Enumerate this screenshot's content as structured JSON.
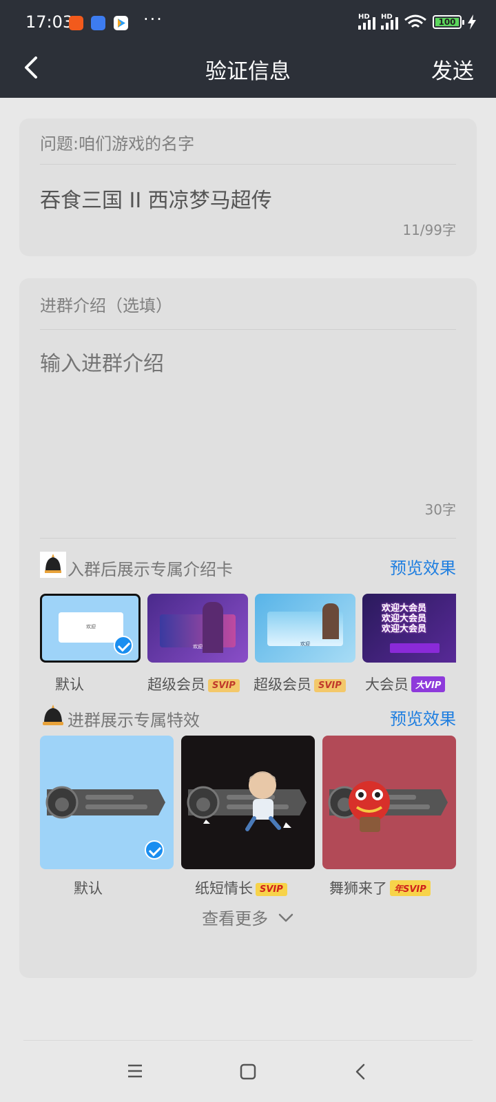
{
  "status": {
    "time": "17:03",
    "dots": "···",
    "battery": "100",
    "hd": "HD"
  },
  "nav": {
    "title": "验证信息",
    "send": "发送"
  },
  "question": {
    "label": "问题:咱们游戏的名字",
    "answer": "吞食三国 II 西凉梦马超传",
    "count": "11/99字"
  },
  "intro": {
    "label": "进群介绍（选填）",
    "placeholder": "输入进群介绍",
    "count": "30字"
  },
  "intro_card": {
    "title": "入群后展示专属介绍卡",
    "preview": "预览效果",
    "options": [
      {
        "label": "默认",
        "badge": ""
      },
      {
        "label": "超级会员",
        "badge": "SVIP"
      },
      {
        "label": "超级会员",
        "badge": "SVIP"
      },
      {
        "label": "大会员",
        "badge": "大VIP"
      }
    ],
    "tile_texts": {
      "welcome": "欢迎",
      "big_welcome": "欢迎大会员"
    }
  },
  "effects": {
    "title": "进群展示专属特效",
    "preview": "预览效果",
    "options": [
      {
        "label": "默认",
        "badge": ""
      },
      {
        "label": "纸短情长",
        "badge": "SVIP"
      },
      {
        "label": "舞狮来了",
        "badge": "年SVIP"
      }
    ],
    "more": "查看更多"
  }
}
